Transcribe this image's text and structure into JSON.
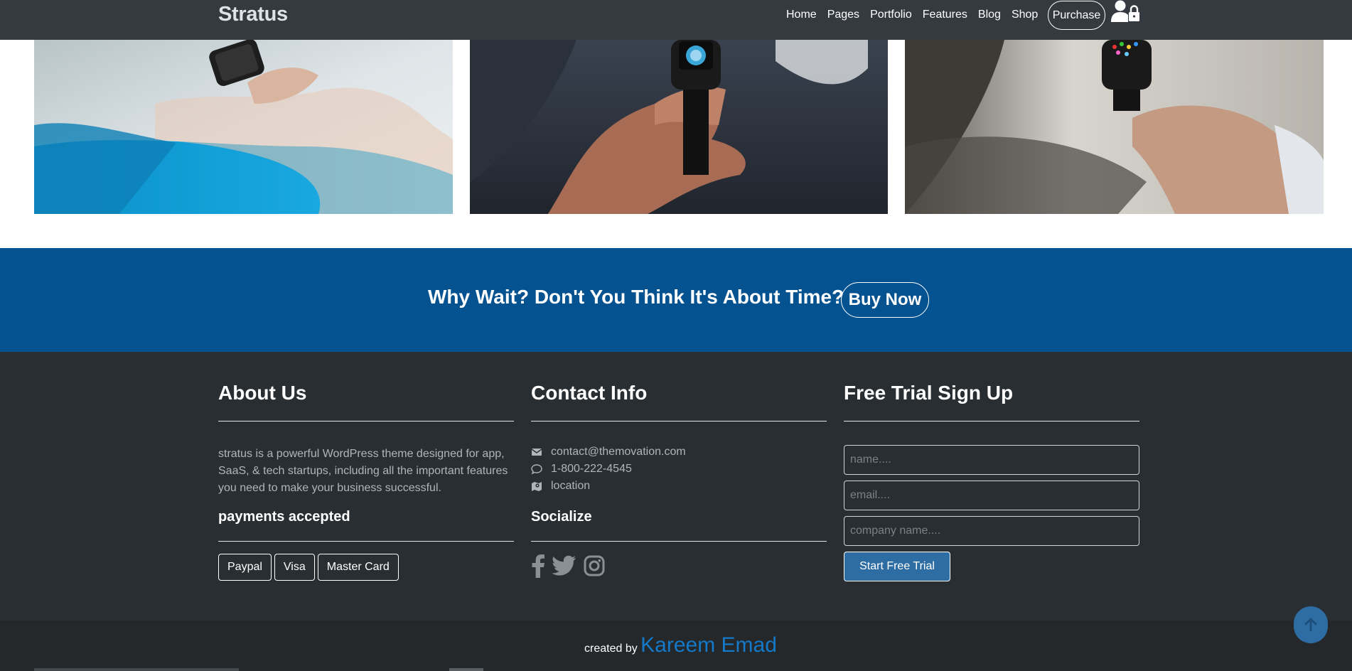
{
  "navbar": {
    "brand": "Stratus",
    "links": [
      "Home",
      "Pages",
      "Portfolio",
      "Features",
      "Blog",
      "Shop"
    ],
    "purchase_label": "Purchase"
  },
  "cta": {
    "text": "Why Wait? Don't You Think It's About Time?",
    "button_label": "Buy Now"
  },
  "footer": {
    "about": {
      "title": "About Us",
      "text": "stratus is a powerful WordPress theme designed for app, SaaS, & tech startups, including all the important features you need to make your business successful.",
      "payments_title": "payments accepted",
      "payments": [
        "Paypal",
        "Visa",
        "Master Card"
      ]
    },
    "contact": {
      "title": "Contact Info",
      "email": "contact@themovation.com",
      "phone": "1-800-222-4545",
      "location": "location",
      "socialize_title": "Socialize"
    },
    "trial": {
      "title": "Free Trial Sign Up",
      "name_placeholder": "name....",
      "email_placeholder": "email....",
      "company_placeholder": "company name....",
      "button_label": "Start Free Trial"
    }
  },
  "credit": {
    "prefix": "created by",
    "author": "Kareem Emad"
  },
  "colors": {
    "navbar": "#343a40",
    "cta": "#055290",
    "footer": "#292e32",
    "bottom_bar": "#24282b",
    "accent": "#2e6da4",
    "author": "#1479c8"
  }
}
